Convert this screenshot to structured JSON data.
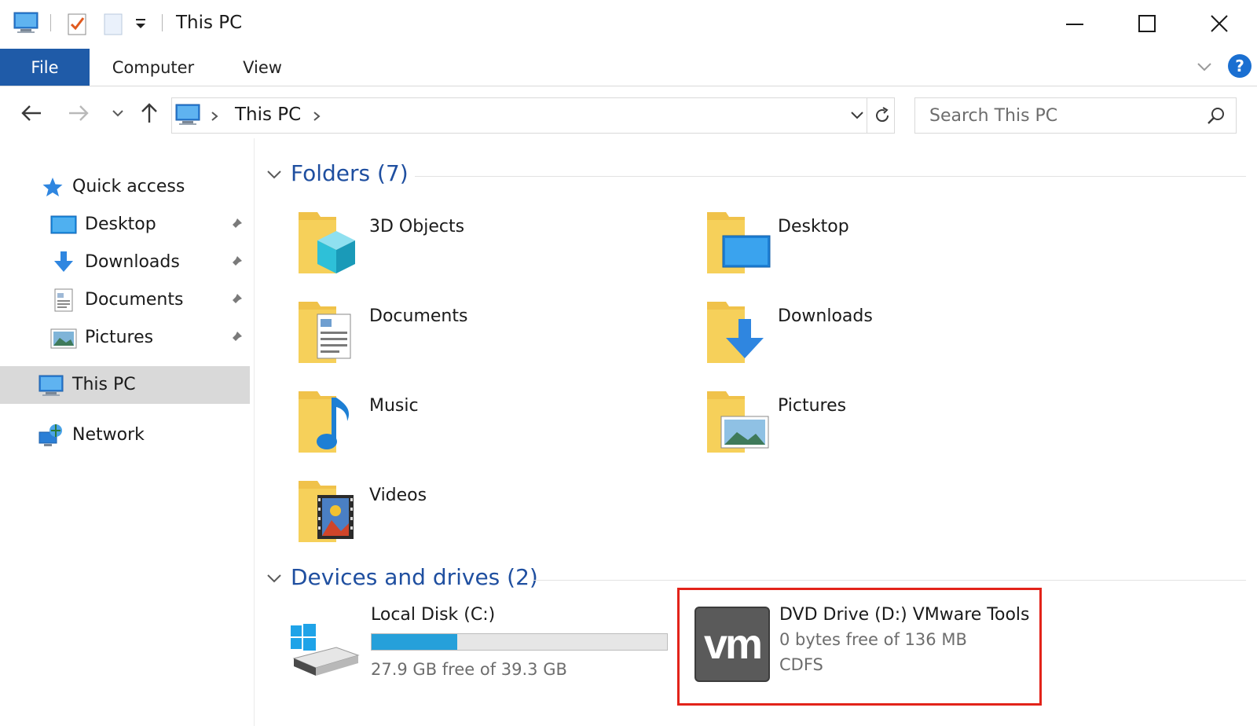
{
  "window": {
    "title": "This PC"
  },
  "ribbon": {
    "tabs": [
      "File",
      "Computer",
      "View"
    ],
    "help_label": "?"
  },
  "address_bar": {
    "path_label": "This PC",
    "search_placeholder": "Search This PC"
  },
  "sidebar": {
    "quick_access": "Quick access",
    "pinned": [
      {
        "label": "Desktop",
        "icon": "desktop-icon"
      },
      {
        "label": "Downloads",
        "icon": "downloads-icon"
      },
      {
        "label": "Documents",
        "icon": "documents-icon"
      },
      {
        "label": "Pictures",
        "icon": "pictures-icon"
      }
    ],
    "this_pc": "This PC",
    "network": "Network"
  },
  "folders": {
    "title": "Folders (7)",
    "items": [
      {
        "label": "3D Objects",
        "icon": "3d-objects-folder-icon"
      },
      {
        "label": "Desktop",
        "icon": "desktop-folder-icon"
      },
      {
        "label": "Documents",
        "icon": "documents-folder-icon"
      },
      {
        "label": "Downloads",
        "icon": "downloads-folder-icon"
      },
      {
        "label": "Music",
        "icon": "music-folder-icon"
      },
      {
        "label": "Pictures",
        "icon": "pictures-folder-icon"
      },
      {
        "label": "Videos",
        "icon": "videos-folder-icon"
      }
    ]
  },
  "drives": {
    "title": "Devices and drives (2)",
    "items": [
      {
        "name": "Local Disk (C:)",
        "free_text": "27.9 GB free of 39.3 GB",
        "used_fraction": 0.29,
        "icon": "windows-disk-icon"
      },
      {
        "name": "DVD Drive (D:) VMware Tools",
        "free_text": "0 bytes free of 136 MB",
        "filesystem": "CDFS",
        "icon": "vmware-logo-icon",
        "logo_text": "vm"
      }
    ]
  },
  "colors": {
    "file_tab": "#1f5ba8",
    "section_title": "#1f4fa0",
    "usage_bar": "#26a0da",
    "highlight": "#e2231a",
    "folder_yellow": "#f6d05a"
  }
}
